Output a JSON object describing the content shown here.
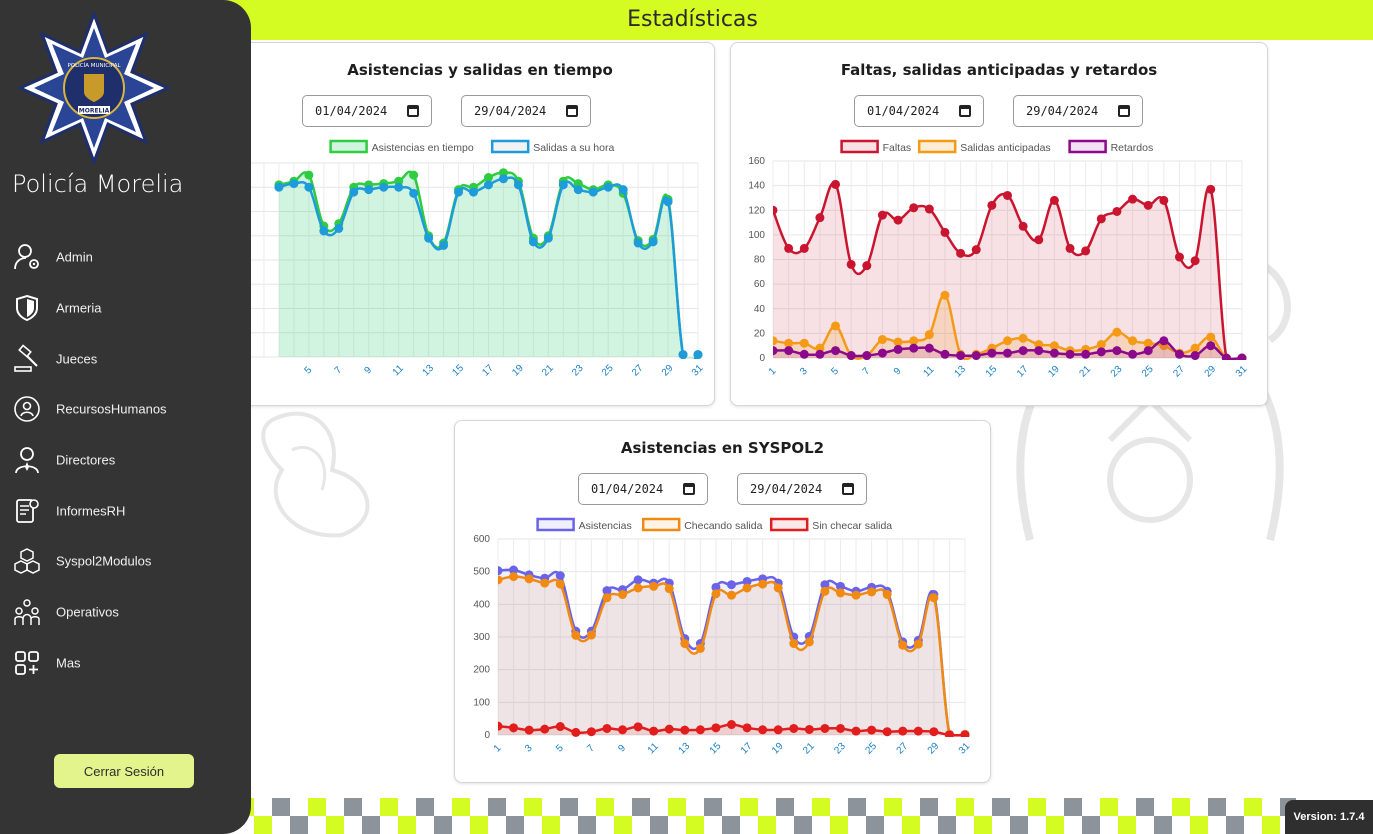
{
  "header": {
    "title": "Estadísticas"
  },
  "sidebar": {
    "logo_text_top": "POLICÍA MUNICIPAL",
    "logo_text_bottom": "MORELIA",
    "brand": "Policía Morelia",
    "items": [
      {
        "label": "Admin",
        "icon": "user-gear-icon"
      },
      {
        "label": "Armeria",
        "icon": "shield-icon"
      },
      {
        "label": "Jueces",
        "icon": "gavel-icon"
      },
      {
        "label": "RecursosHumanos",
        "icon": "hr-network-icon"
      },
      {
        "label": "Directores",
        "icon": "director-icon"
      },
      {
        "label": "InformesRH",
        "icon": "report-icon"
      },
      {
        "label": "Syspol2Modulos",
        "icon": "cubes-icon"
      },
      {
        "label": "Operativos",
        "icon": "team-icon"
      },
      {
        "label": "Mas",
        "icon": "grid-plus-icon"
      }
    ],
    "logout_label": "Cerrar Sesión"
  },
  "version": "Version: 1.7.4",
  "colors": {
    "accent": "#d4fc22",
    "sidebar": "#343434",
    "logout": "#e4f48c"
  },
  "chart_data": [
    {
      "type": "line",
      "title": "Asistencias y salidas en tiempo",
      "date_from": "01/04/2024",
      "date_to": "29/04/2024",
      "x_ticks": [
        "5",
        "7",
        "9",
        "11",
        "13",
        "15",
        "17",
        "19",
        "21",
        "23",
        "25",
        "27",
        "29",
        "31"
      ],
      "x": [
        3,
        4,
        5,
        6,
        7,
        8,
        9,
        10,
        11,
        12,
        13,
        14,
        15,
        16,
        17,
        18,
        19,
        20,
        21,
        22,
        23,
        24,
        25,
        26,
        27,
        28,
        29,
        30,
        31
      ],
      "series": [
        {
          "name": "Asistencias en tiempo",
          "color": "#2ecc40",
          "fill": "rgba(46,204,113,0.22)",
          "values": [
            142,
            145,
            150,
            108,
            110,
            140,
            142,
            143,
            145,
            150,
            100,
            94,
            138,
            140,
            148,
            152,
            145,
            98,
            100,
            145,
            143,
            138,
            142,
            135,
            96,
            97,
            130,
            2,
            2
          ]
        },
        {
          "name": "Salidas a su hora",
          "color": "#1e9bdb",
          "fill": "",
          "values": [
            140,
            143,
            140,
            104,
            106,
            136,
            138,
            140,
            140,
            135,
            98,
            92,
            136,
            136,
            142,
            147,
            142,
            95,
            98,
            142,
            138,
            136,
            140,
            138,
            94,
            95,
            128,
            2,
            2
          ]
        }
      ],
      "ylim": [
        0,
        160
      ]
    },
    {
      "type": "line",
      "title": "Faltas, salidas anticipadas y retardos",
      "date_from": "01/04/2024",
      "date_to": "29/04/2024",
      "y_ticks": [
        "0",
        "20",
        "40",
        "60",
        "80",
        "100",
        "120",
        "140",
        "160"
      ],
      "x_ticks": [
        "1",
        "3",
        "5",
        "7",
        "9",
        "11",
        "13",
        "15",
        "17",
        "19",
        "21",
        "23",
        "25",
        "27",
        "29",
        "31"
      ],
      "x": [
        1,
        2,
        3,
        4,
        5,
        6,
        7,
        8,
        9,
        10,
        11,
        12,
        13,
        14,
        15,
        16,
        17,
        18,
        19,
        20,
        21,
        22,
        23,
        24,
        25,
        26,
        27,
        28,
        29,
        30,
        31
      ],
      "series": [
        {
          "name": "Faltas",
          "color": "#c9152f",
          "fill": "rgba(201,21,47,0.13)",
          "values": [
            120,
            89,
            89,
            114,
            141,
            76,
            75,
            116,
            112,
            122,
            121,
            102,
            85,
            88,
            124,
            132,
            107,
            96,
            128,
            89,
            87,
            113,
            119,
            129,
            124,
            128,
            82,
            79,
            137,
            0,
            0
          ]
        },
        {
          "name": "Salidas anticipadas",
          "color": "#f59a16",
          "fill": "rgba(245,154,22,0.18)",
          "values": [
            14,
            12,
            12,
            8,
            26,
            2,
            2,
            15,
            13,
            14,
            19,
            51,
            3,
            3,
            8,
            14,
            16,
            11,
            10,
            6,
            7,
            11,
            21,
            14,
            12,
            10,
            4,
            8,
            17,
            0,
            0
          ]
        },
        {
          "name": "Retardos",
          "color": "#8b0a8b",
          "fill": "rgba(139,10,139,0.12)",
          "values": [
            6,
            6,
            3,
            3,
            6,
            2,
            2,
            4,
            7,
            8,
            8,
            3,
            2,
            2,
            4,
            4,
            6,
            6,
            4,
            3,
            3,
            5,
            6,
            3,
            6,
            14,
            3,
            2,
            10,
            0,
            0
          ]
        }
      ],
      "ylim": [
        0,
        160
      ]
    },
    {
      "type": "line",
      "title": "Asistencias en SYSPOL2",
      "date_from": "01/04/2024",
      "date_to": "29/04/2024",
      "y_ticks": [
        "0",
        "100",
        "200",
        "300",
        "400",
        "500",
        "600"
      ],
      "x_ticks": [
        "1",
        "3",
        "5",
        "7",
        "9",
        "11",
        "13",
        "15",
        "17",
        "19",
        "21",
        "23",
        "25",
        "27",
        "29",
        "31"
      ],
      "x": [
        1,
        2,
        3,
        4,
        5,
        6,
        7,
        8,
        9,
        10,
        11,
        12,
        13,
        14,
        15,
        16,
        17,
        18,
        19,
        20,
        21,
        22,
        23,
        24,
        25,
        26,
        27,
        28,
        29,
        30,
        31
      ],
      "series": [
        {
          "name": "Asistencias",
          "color": "#6a63e8",
          "fill": "rgba(106,99,232,0.10)",
          "values": [
            503,
            505,
            490,
            480,
            488,
            318,
            318,
            442,
            445,
            475,
            465,
            465,
            295,
            280,
            452,
            460,
            470,
            478,
            465,
            300,
            302,
            460,
            455,
            440,
            452,
            440,
            285,
            290,
            430,
            2,
            2
          ]
        },
        {
          "name": "Checando salida",
          "color": "#f08a12",
          "fill": "rgba(240,138,18,0.10)",
          "values": [
            475,
            485,
            478,
            465,
            462,
            305,
            306,
            420,
            430,
            450,
            455,
            448,
            280,
            265,
            432,
            428,
            450,
            462,
            450,
            280,
            285,
            440,
            435,
            428,
            438,
            430,
            275,
            278,
            420,
            2,
            2
          ]
        },
        {
          "name": "Sin checar salida",
          "color": "#e11d1d",
          "fill": "rgba(225,29,29,0.10)",
          "values": [
            27,
            22,
            15,
            18,
            26,
            8,
            10,
            20,
            16,
            25,
            12,
            18,
            15,
            16,
            22,
            32,
            22,
            16,
            16,
            20,
            17,
            20,
            20,
            12,
            15,
            10,
            12,
            12,
            10,
            0,
            0
          ]
        }
      ],
      "ylim": [
        0,
        600
      ]
    }
  ]
}
